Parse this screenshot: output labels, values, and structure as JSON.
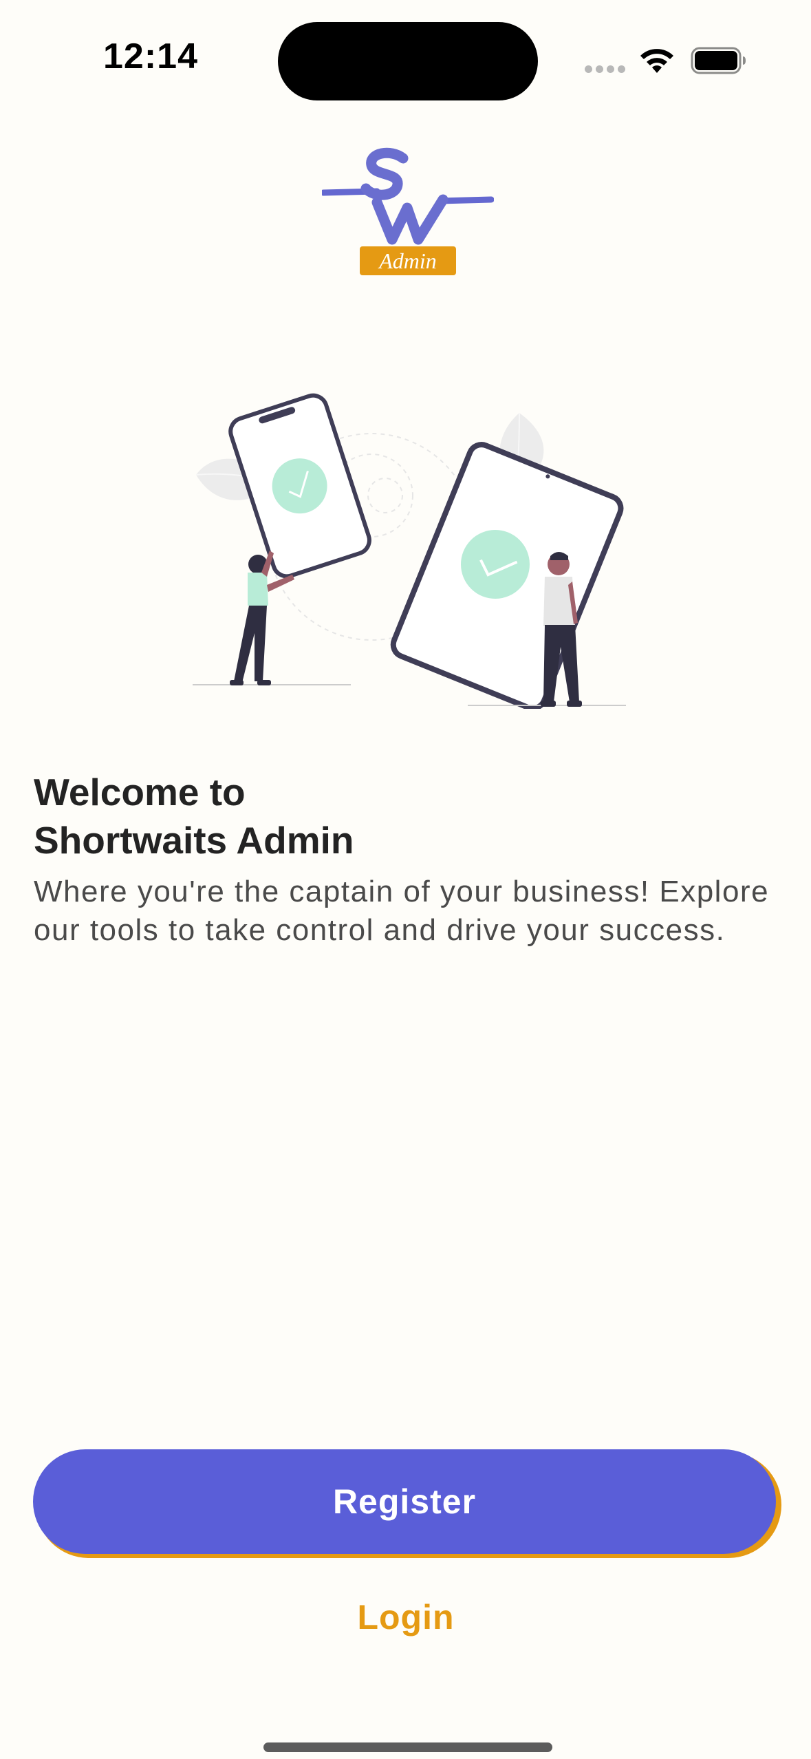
{
  "status_bar": {
    "time": "12:14"
  },
  "logo": {
    "brand_letters": "SW",
    "badge_text": "Admin",
    "brand_color": "#6a6ecf",
    "badge_color": "#e59a13"
  },
  "welcome": {
    "title_line1": "Welcome to",
    "title_line2": "Shortwaits Admin",
    "subtitle": "Where you're the captain of your business! Explore our tools to take control and drive your success."
  },
  "actions": {
    "register_label": "Register",
    "login_label": "Login"
  },
  "colors": {
    "background": "#fefdf9",
    "primary": "#5a5ed8",
    "accent": "#e59a13",
    "illustration_check": "#b8ecd7"
  },
  "icons": {
    "signal": "cellular-signal-icon",
    "wifi": "wifi-icon",
    "battery": "battery-icon"
  }
}
